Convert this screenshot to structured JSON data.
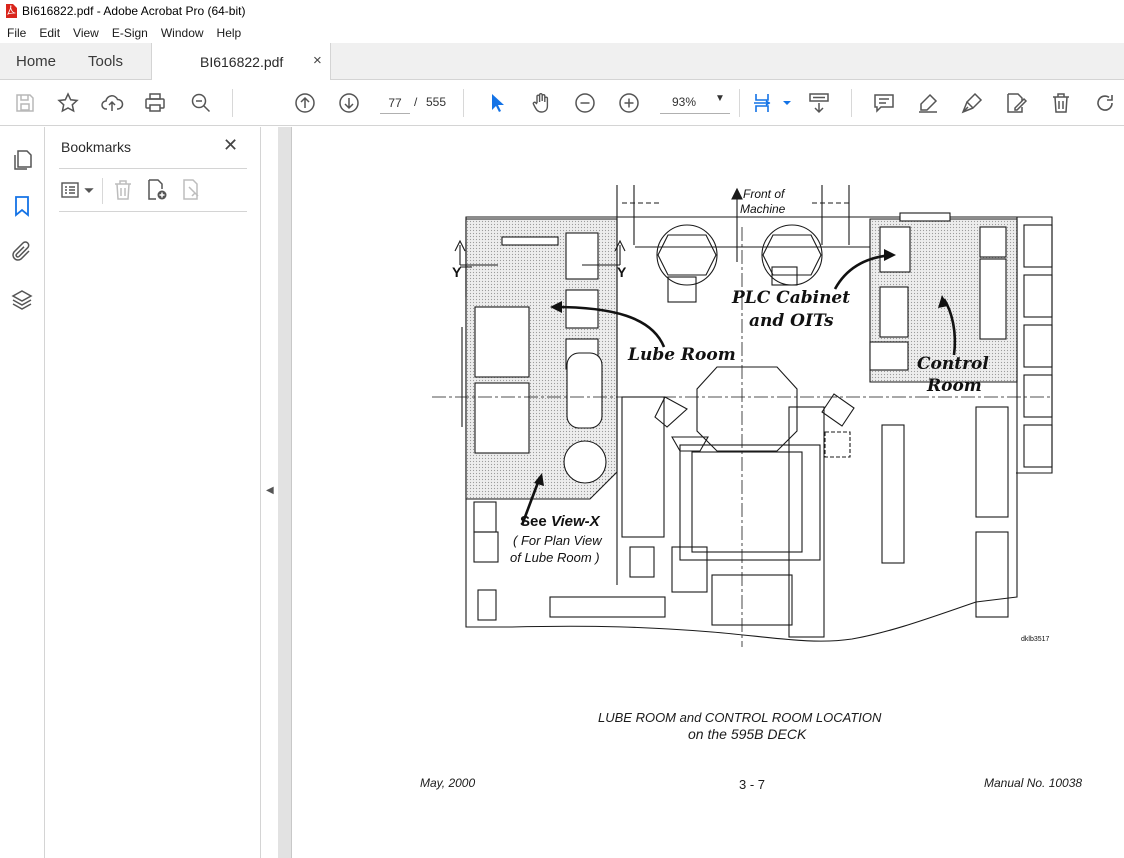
{
  "window": {
    "title": "BI616822.pdf - Adobe Acrobat Pro (64-bit)"
  },
  "menu": [
    "File",
    "Edit",
    "View",
    "E-Sign",
    "Window",
    "Help"
  ],
  "tabs": {
    "home": "Home",
    "tools": "Tools",
    "document": "BI616822.pdf",
    "close": "×"
  },
  "toolbar": {
    "page_current": "77",
    "page_separator": "/",
    "page_total": "555",
    "zoom": "93%"
  },
  "bookmarks": {
    "title": "Bookmarks",
    "close": "✕"
  },
  "document": {
    "figure_labels": {
      "front_of_machine_1": "Front of",
      "front_of_machine_2": "Machine",
      "plc_cabinet_1": "PLC Cabinet",
      "plc_cabinet_2": "and OITs",
      "lube_room": "Lube Room",
      "control_room_1": "Control",
      "control_room_2": "Room",
      "see_view_prefix": "See",
      "see_view_suffix": "View-X",
      "plan_view_1": "( For Plan View",
      "plan_view_2": "of Lube Room )",
      "y_left": "Y",
      "y_right": "Y",
      "drawing_id": "dklb3517"
    },
    "caption_line1": "LUBE ROOM and CONTROL ROOM LOCATION",
    "caption_line2": "on the 595B DECK",
    "footer": {
      "date": "May, 2000",
      "page": "3 - 7",
      "manual": "Manual No. 10038"
    }
  },
  "colors": {
    "pdf_red": "#d9251c",
    "select_blue": "#1473e6",
    "room_fill": "#dcdcdc"
  }
}
